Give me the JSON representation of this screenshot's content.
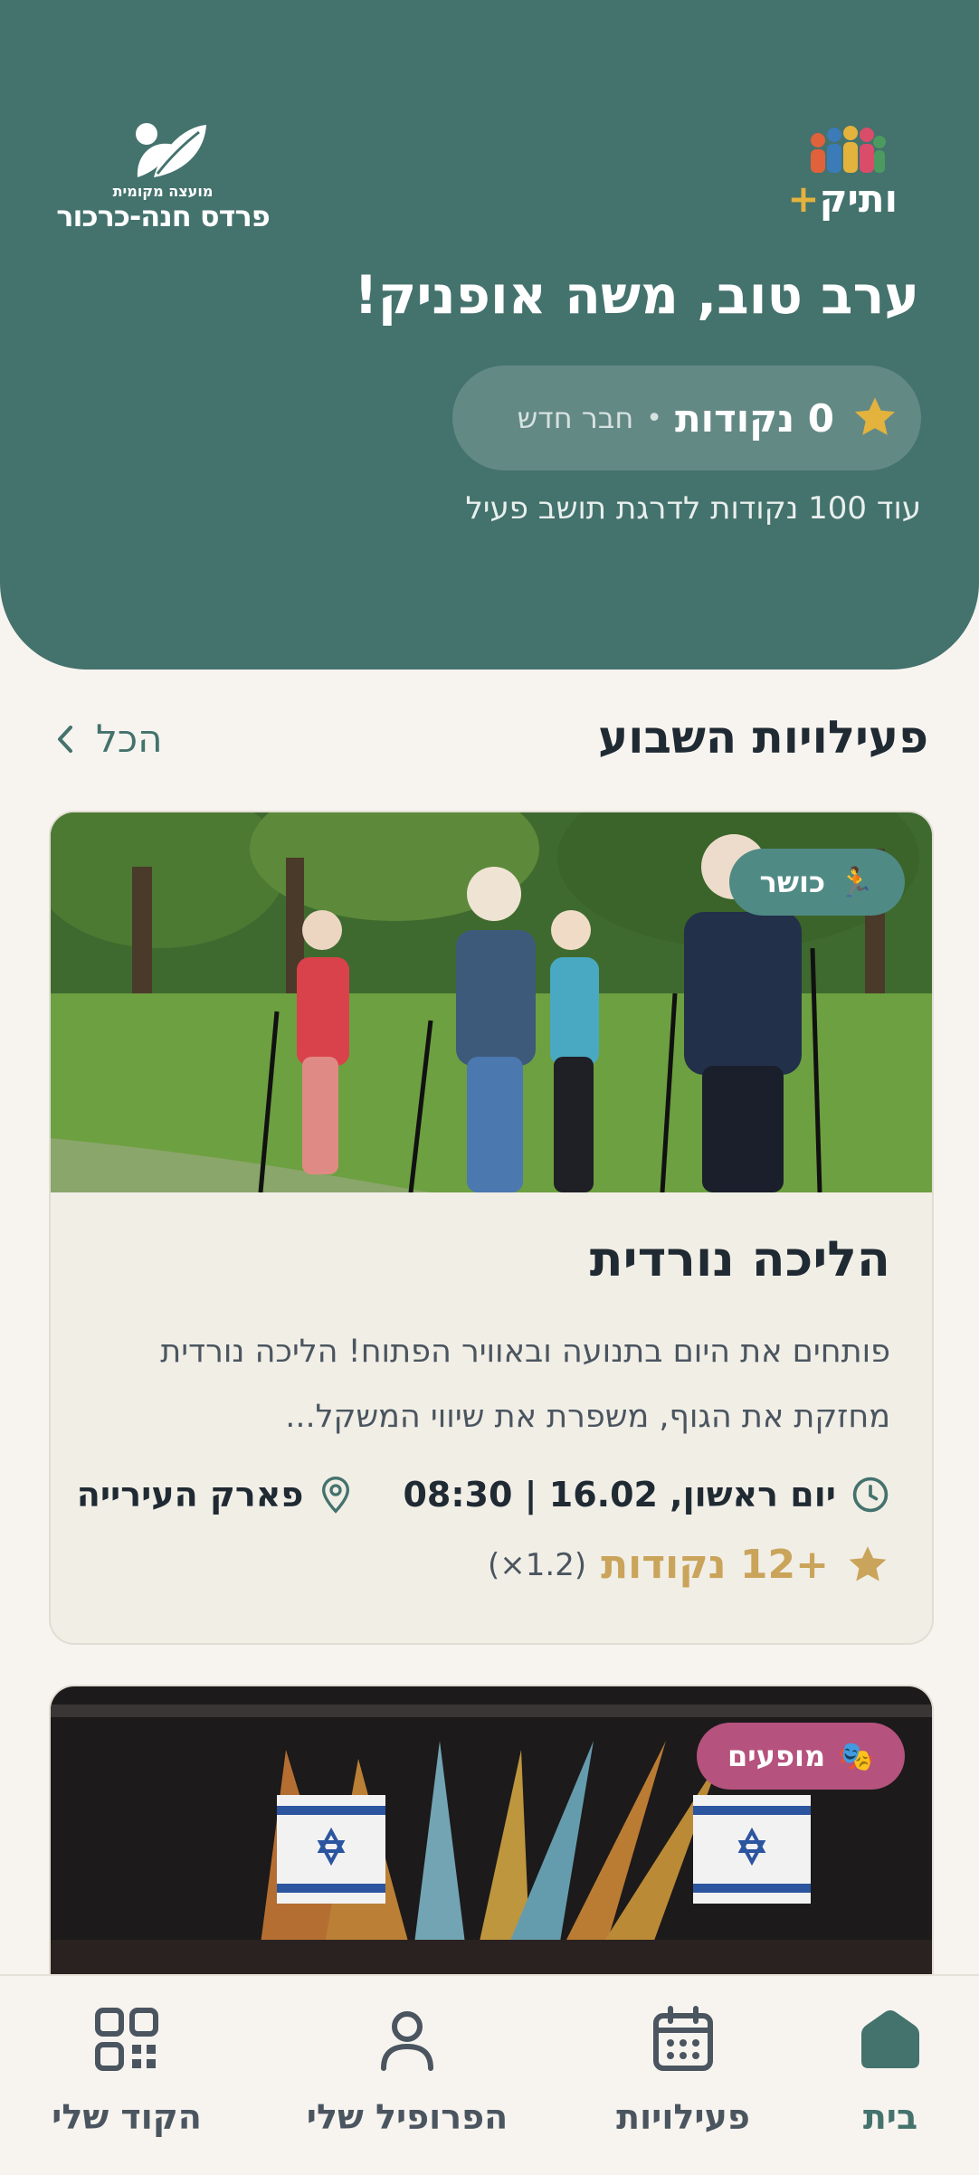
{
  "header": {
    "logo_left_small": "מועצה מקומית",
    "logo_left_big": "פרדס חנה-כרכור",
    "logo_right_text": "ותיק",
    "logo_right_plus": "+",
    "greeting": "ערב טוב, משה אופניק!",
    "points": "0 נקודות",
    "separator": "•",
    "level": "חבר חדש",
    "progress_text": "עוד 100 נקודות לדרגת תושב פעיל"
  },
  "section": {
    "title": "פעילויות השבוע",
    "see_all": "הכל"
  },
  "activities": [
    {
      "badge_emoji": "🏃",
      "badge": "כושר",
      "badge_color": "#4f8a84",
      "title": "הליכה נורדית",
      "description": "פותחים את היום בתנועה ובאוויר הפתוח! הליכה נורדית מחזקת את הגוף, משפרת את שיווי המשקל...",
      "datetime": "יום ראשון, 16.02 | 08:30",
      "location": "פארק העירייה",
      "reward": "+12 נקודות",
      "multiplier": "(1.2×)"
    },
    {
      "badge_emoji": "🎭",
      "badge": "מופעים",
      "badge_color": "#b5527e"
    }
  ],
  "nav": {
    "home": "בית",
    "activities": "פעילויות",
    "profile": "הפרופיל שלי",
    "code": "הקוד שלי"
  },
  "colors": {
    "primary": "#44726d",
    "background": "#f7f4ef",
    "gold": "#c9a45a"
  }
}
